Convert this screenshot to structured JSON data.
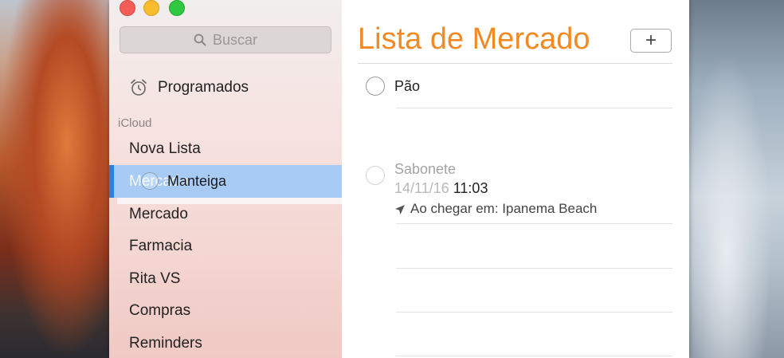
{
  "search": {
    "placeholder": "Buscar"
  },
  "sidebar": {
    "scheduled_label": "Programados",
    "section_header": "iCloud",
    "drag_under_label": "Mercado",
    "drag_item_label": "Manteiga",
    "lists": [
      "Nova Lista",
      "Mercado",
      "Farmacia",
      "Rita VS",
      "Compras",
      "Reminders"
    ]
  },
  "main": {
    "title": "Lista de Mercado",
    "add_label": "+",
    "reminders": [
      {
        "title": "Pão",
        "completed": false
      },
      {
        "title": "Sabonete",
        "date": "14/11/16",
        "time": "11:03",
        "location": "Ao chegar em: Ipanema Beach",
        "completed": true
      }
    ]
  },
  "colors": {
    "accent": "#f28a24",
    "selection": "#a7cbf4",
    "selection_edge": "#2f7fde",
    "close": "#f25e57",
    "minimize": "#f7bd2d",
    "maximize": "#2fc840"
  },
  "icons": {
    "search": "search-icon",
    "scheduled": "alarm-clock-icon",
    "location": "location-arrow-icon"
  }
}
